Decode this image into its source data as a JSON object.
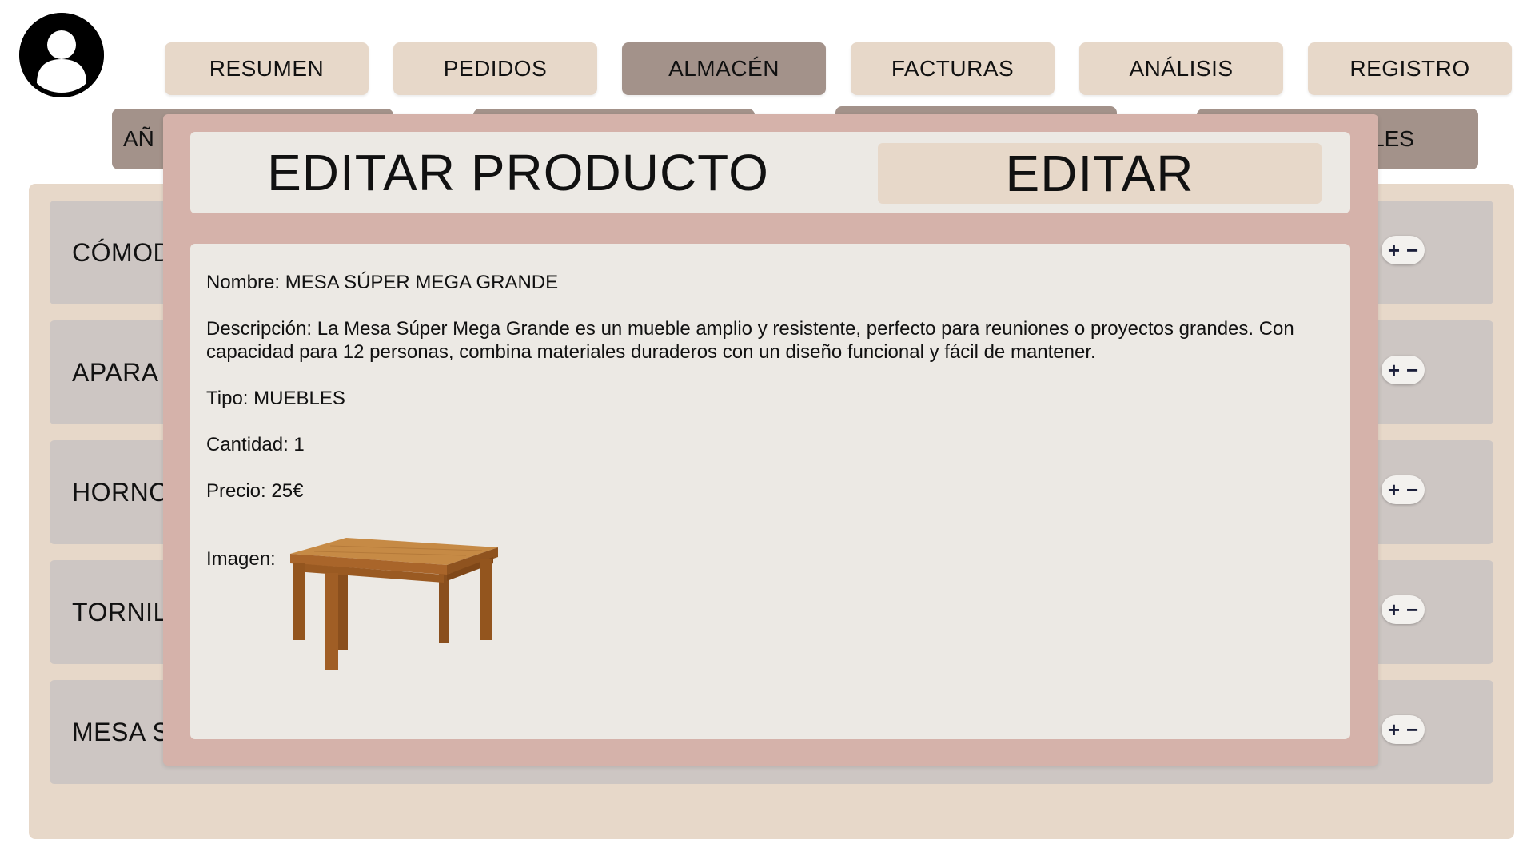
{
  "user": {
    "avatar_icon": "user-avatar-icon"
  },
  "nav": {
    "tabs": [
      {
        "label": "RESUMEN"
      },
      {
        "label": "PEDIDOS"
      },
      {
        "label": "ALMACÉN",
        "active": true
      },
      {
        "label": "FACTURAS"
      },
      {
        "label": "ANÁLISIS"
      },
      {
        "label": "REGISTRO"
      }
    ]
  },
  "subtoolbar": {
    "buttons": [
      {
        "label": "AÑ"
      },
      {
        "label": ""
      },
      {
        "label": ""
      },
      {
        "label": "LES"
      }
    ]
  },
  "warehouse": {
    "items": [
      {
        "name": "CÓMOD"
      },
      {
        "name": "APARA"
      },
      {
        "name": "HORNO"
      },
      {
        "name": "TORNIL"
      },
      {
        "name": "MESA S"
      }
    ],
    "stepper": {
      "plus": "+",
      "minus": "−"
    }
  },
  "modal": {
    "title": "EDITAR PRODUCTO",
    "edit_label": "EDITAR",
    "fields": {
      "name_label": "Nombre:",
      "name_value": "MESA SÚPER MEGA GRANDE",
      "description_label": "Descripción:",
      "description_value": "La Mesa Súper Mega Grande es un mueble amplio y resistente, perfecto para reuniones o proyectos grandes. Con capacidad para 12 personas, combina materiales duraderos con un diseño funcional y fácil de mantener.",
      "type_label": "Tipo:",
      "type_value": "MUEBLES",
      "quantity_label": "Cantidad:",
      "quantity_value": "1",
      "price_label": "Precio:",
      "price_value": "25€",
      "image_label": "Imagen:"
    }
  },
  "colors": {
    "nav_tab": "#e7d8c9",
    "nav_tab_active": "#a3928a",
    "panel": "#e7d8c9",
    "row": "#cdc6c3",
    "modal_frame": "#d5b2aa",
    "modal_surface": "#ece9e4"
  }
}
